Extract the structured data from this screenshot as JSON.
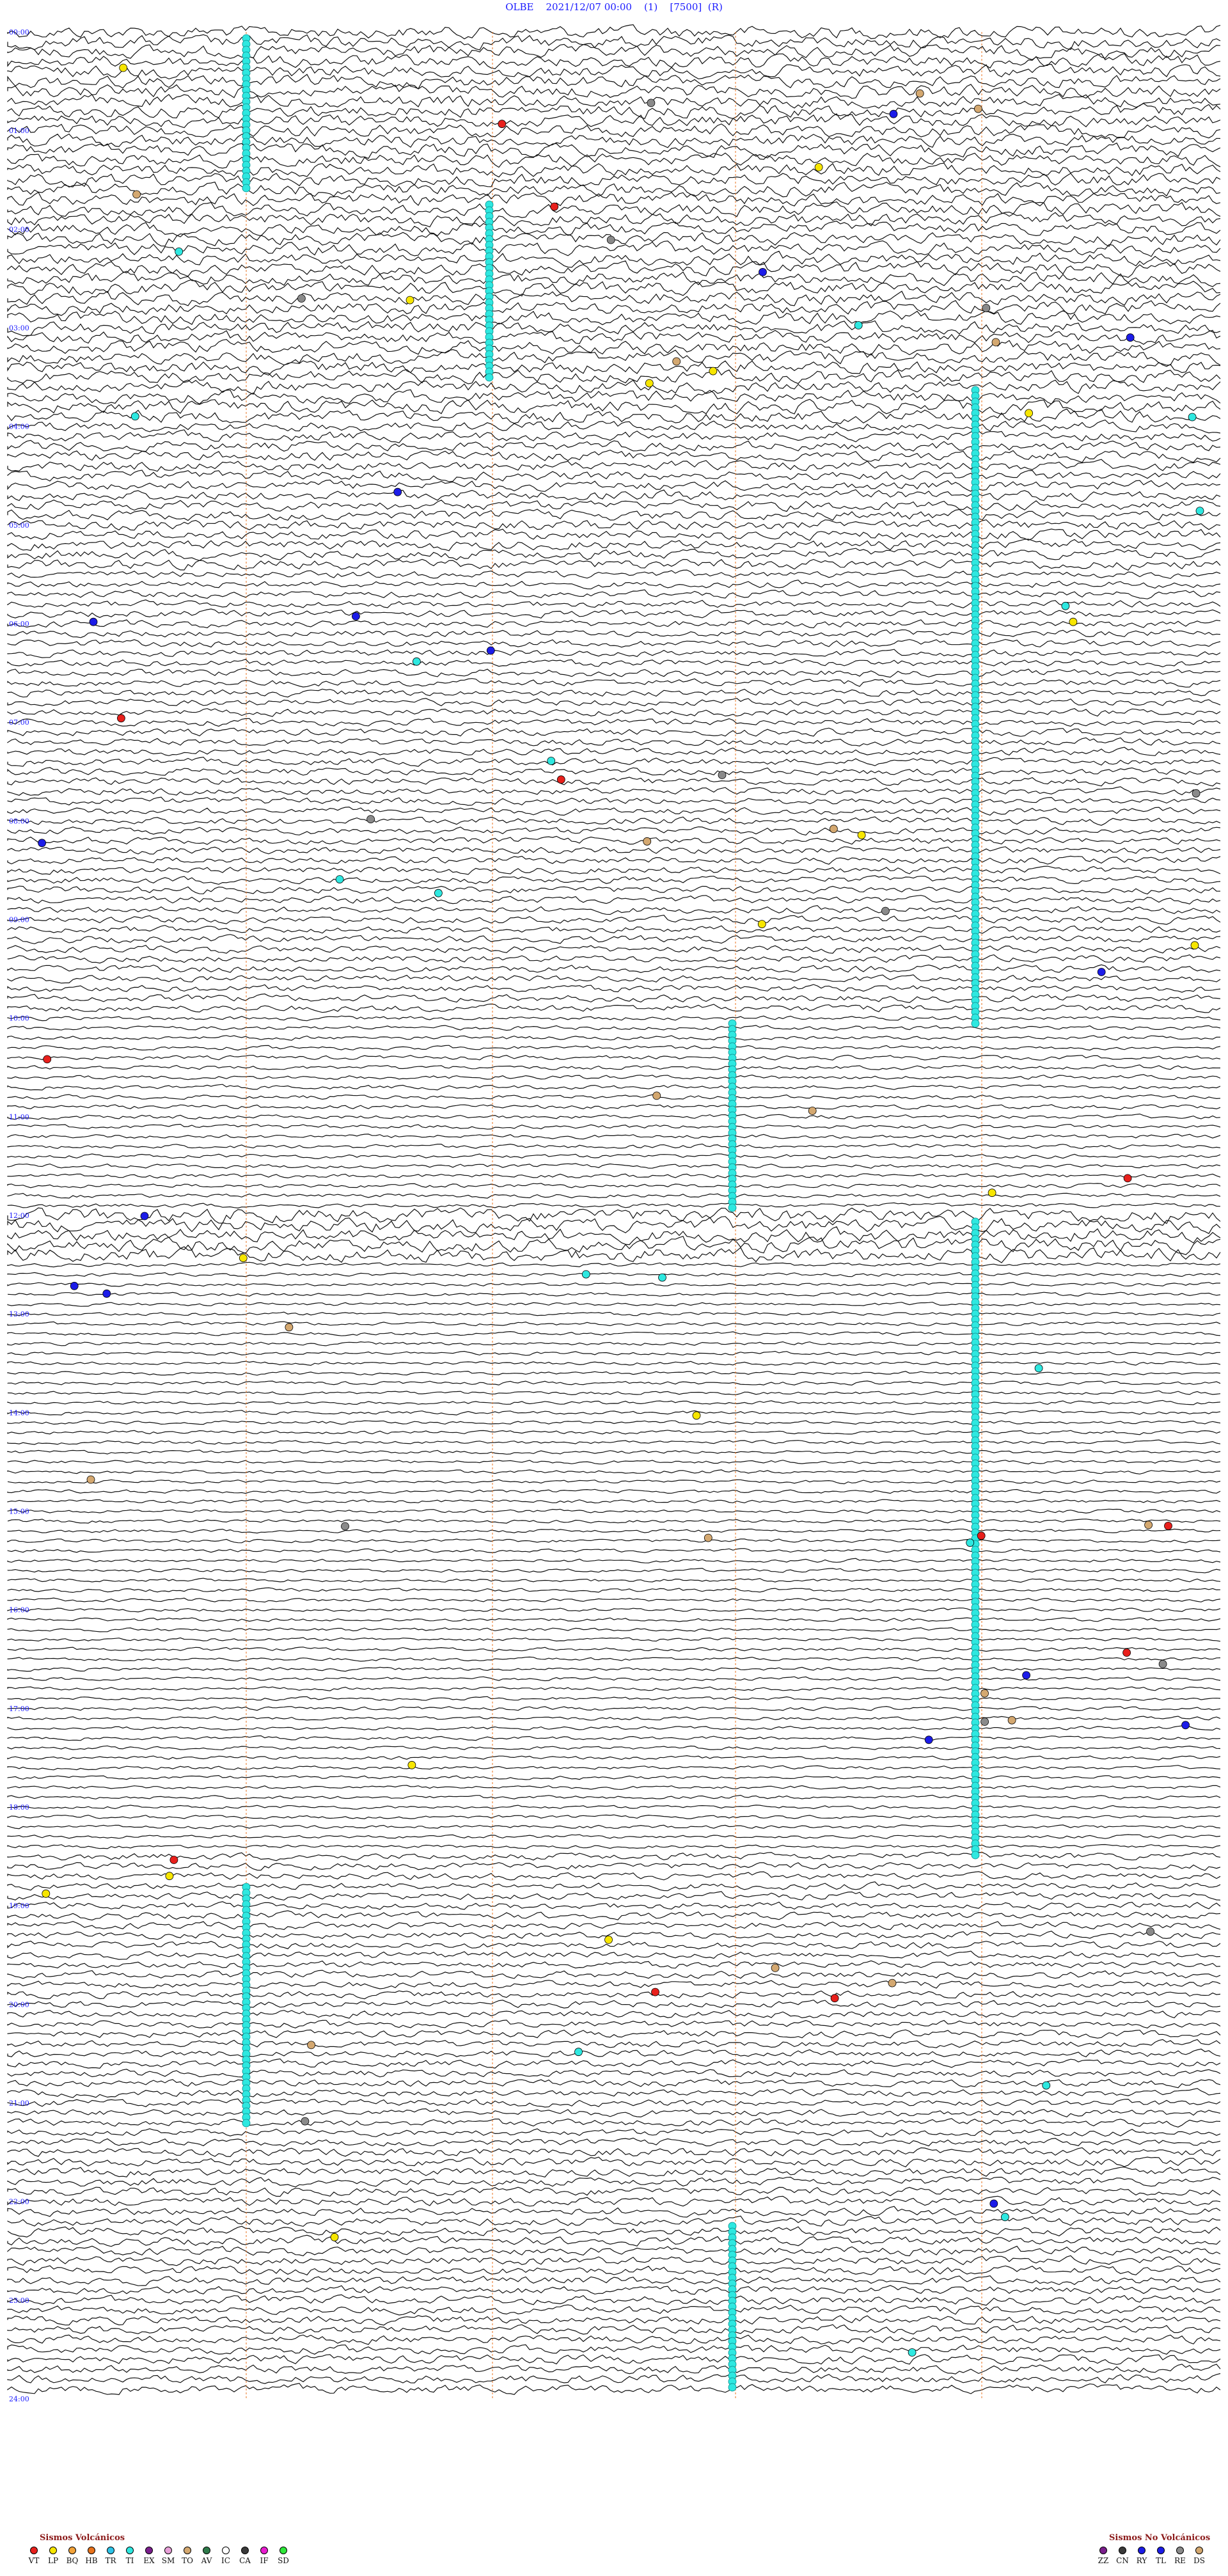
{
  "header": {
    "station": "OLBE",
    "datetime": "2021/12/07 00:00",
    "field1": "(1)",
    "field2": "[7500]",
    "field3": "(R)"
  },
  "hour_labels": [
    "00:00",
    "01:00",
    "02:00",
    "03:00",
    "04:00",
    "05:00",
    "06:00",
    "07:00",
    "08:00",
    "09:00",
    "10:00",
    "11:00",
    "12:00",
    "13:00",
    "14:00",
    "15:00",
    "16:00",
    "17:00",
    "18:00",
    "19:00",
    "20:00",
    "21:00",
    "22:00",
    "23:00",
    "24:00"
  ],
  "legend_volcanic": {
    "title": "Sismos Volcánicos",
    "items": [
      {
        "code": "VT",
        "color": "#e8201c"
      },
      {
        "code": "LP",
        "color": "#f7e600"
      },
      {
        "code": "BQ",
        "color": "#f3a33a"
      },
      {
        "code": "HB",
        "color": "#e8721c"
      },
      {
        "code": "TR",
        "color": "#2ec4e8"
      },
      {
        "code": "TI",
        "color": "#2ee8e0"
      },
      {
        "code": "EX",
        "color": "#7a1e8c"
      },
      {
        "code": "SM",
        "color": "#e8a0d8"
      },
      {
        "code": "TO",
        "color": "#d4a870"
      },
      {
        "code": "AV",
        "color": "#2e7a4a"
      },
      {
        "code": "IC",
        "color": "#ffffff"
      },
      {
        "code": "CA",
        "color": "#3a3a3a"
      },
      {
        "code": "IF",
        "color": "#e81cd0"
      },
      {
        "code": "SD",
        "color": "#2ee83a"
      }
    ]
  },
  "legend_non_volcanic": {
    "title": "Sismos No Volcánicos",
    "items": [
      {
        "code": "ZZ",
        "color": "#7a1e8c"
      },
      {
        "code": "CN",
        "color": "#3a3a3a"
      },
      {
        "code": "RY",
        "color": "#1c1ce8"
      },
      {
        "code": "TL",
        "color": "#1c1ce8"
      },
      {
        "code": "RE",
        "color": "#8a8a8a"
      },
      {
        "code": "DS",
        "color": "#d4a870"
      }
    ]
  }
}
